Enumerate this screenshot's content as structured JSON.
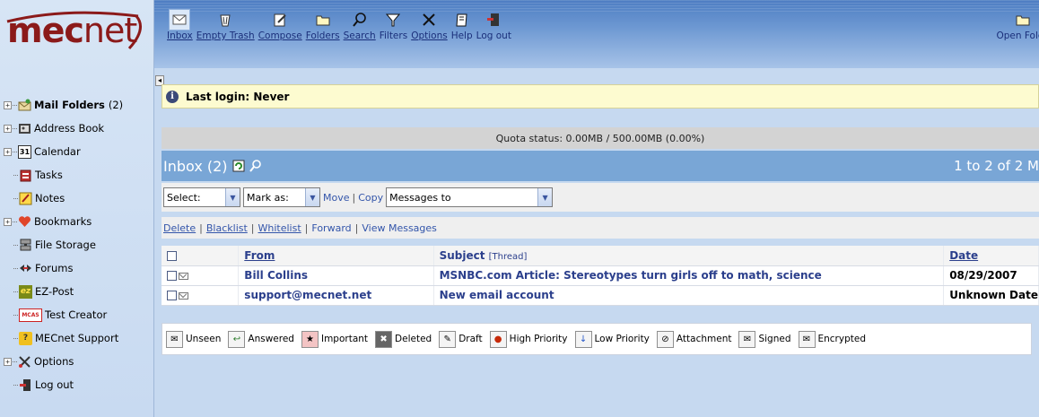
{
  "logo": {
    "text_bold": "mec",
    "text_thin": "net",
    "mark": "™"
  },
  "sidebar": {
    "items": [
      {
        "label": "Mail Folders",
        "count": "(2)",
        "toggle": "+",
        "icon": "mail-folder-icon",
        "bold": true
      },
      {
        "label": "Address Book",
        "toggle": "+",
        "icon": "address-book-icon"
      },
      {
        "label": "Calendar",
        "toggle": "+",
        "icon": "calendar-icon",
        "icon_text": "31"
      },
      {
        "label": "Tasks",
        "toggle": "",
        "icon": "tasks-icon"
      },
      {
        "label": "Notes",
        "toggle": "",
        "icon": "notes-icon"
      },
      {
        "label": "Bookmarks",
        "toggle": "+",
        "icon": "heart-icon"
      },
      {
        "label": "File Storage",
        "toggle": "",
        "icon": "file-storage-icon"
      },
      {
        "label": "Forums",
        "toggle": "",
        "icon": "forums-icon"
      },
      {
        "label": "EZ-Post",
        "toggle": "",
        "icon": "ez-post-icon",
        "icon_text": "ez"
      },
      {
        "label": "Test Creator",
        "toggle": "",
        "icon": "mcas-icon",
        "icon_text": "MCAS"
      },
      {
        "label": "MECnet Support",
        "toggle": "",
        "icon": "help-icon",
        "icon_text": "?"
      },
      {
        "label": "Options",
        "toggle": "+",
        "icon": "tools-icon"
      },
      {
        "label": "Log out",
        "toggle": "",
        "icon": "logout-icon"
      }
    ]
  },
  "toolbar": {
    "buttons": [
      {
        "label": "Inbox",
        "icon": "inbox-icon",
        "active": true,
        "underline": true
      },
      {
        "label": "Empty Trash",
        "icon": "trash-icon",
        "underline": true
      },
      {
        "label": "Compose",
        "icon": "compose-icon",
        "underline": true
      },
      {
        "label": "Folders",
        "icon": "folders-icon",
        "underline": true
      },
      {
        "label": "Search",
        "icon": "search-icon",
        "underline": true
      },
      {
        "label": "Filters",
        "icon": "filter-icon"
      },
      {
        "label": "Options",
        "icon": "options-icon",
        "underline": true
      },
      {
        "label": "Help",
        "icon": "help-book-icon"
      },
      {
        "label": "Log out",
        "icon": "logout-door-icon"
      }
    ],
    "open_folder": "Open Folde"
  },
  "last_login": "Last login: Never",
  "quota": "Quota status: 0.00MB / 500.00MB (0.00%)",
  "inbox_bar": {
    "title": "Inbox (2)",
    "range": "1 to 2 of 2 M"
  },
  "controls": {
    "select": "Select:",
    "mark_as": "Mark as:",
    "move": "Move",
    "copy": "Copy",
    "separator": "|",
    "messages_to": "Messages to"
  },
  "actions": [
    "Delete",
    "Blacklist",
    "Whitelist",
    "Forward",
    "View Messages"
  ],
  "table": {
    "headers": {
      "from": "From",
      "subject": "Subject",
      "thread": "[Thread]",
      "date": "Date"
    },
    "rows": [
      {
        "from": "Bill Collins",
        "subject": "MSNBC.com Article: Stereotypes turn girls off to math, science",
        "date": "08/29/2007"
      },
      {
        "from": "support@mecnet.net",
        "subject": "New email account",
        "date": "Unknown Date"
      }
    ]
  },
  "legend": [
    {
      "label": "Unseen",
      "icon": "unseen-icon"
    },
    {
      "label": "Answered",
      "icon": "answered-icon"
    },
    {
      "label": "Important",
      "icon": "important-icon"
    },
    {
      "label": "Deleted",
      "icon": "deleted-icon"
    },
    {
      "label": "Draft",
      "icon": "draft-icon"
    },
    {
      "label": "High Priority",
      "icon": "high-priority-icon"
    },
    {
      "label": "Low Priority",
      "icon": "low-priority-icon"
    },
    {
      "label": "Attachment",
      "icon": "attachment-icon"
    },
    {
      "label": "Signed",
      "icon": "signed-icon"
    },
    {
      "label": "Encrypted",
      "icon": "encrypted-icon"
    }
  ],
  "colors": {
    "brand": "#8b1a1a",
    "toolbar": "#6d98d2",
    "inbox_bar": "#79a6d6",
    "link": "#2b3f8c",
    "login_bg": "#fdfbd0"
  }
}
